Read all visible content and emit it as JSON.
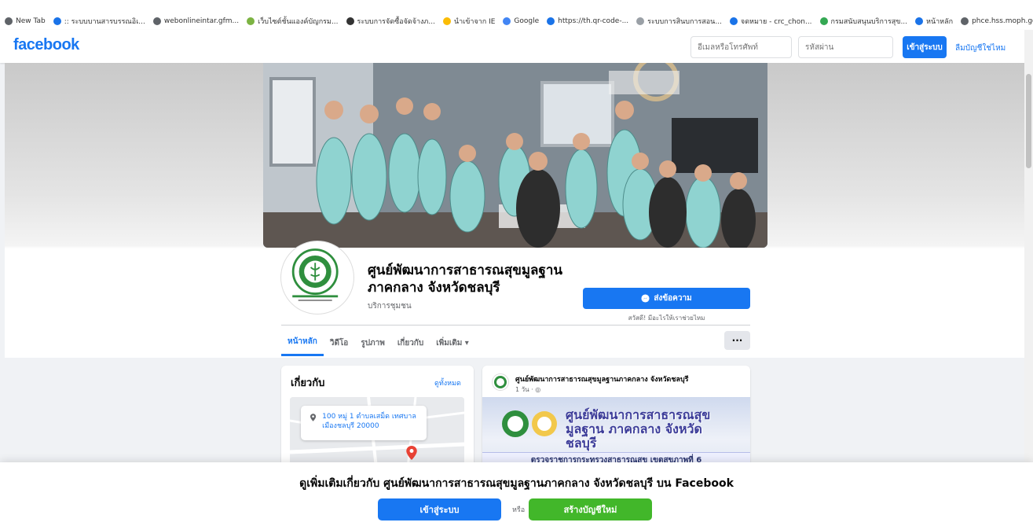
{
  "browser": {
    "bookmarks": [
      "New Tab",
      ":: ระบบบานสารบรรณอิเ...",
      "webonlineintar.gfm...",
      "เว็บไซต์ชั้นแองค์บัญกรม...",
      "ระบบการจัดซื้อจัดจ้างภ...",
      "นำเข้าจาก IE",
      "Google",
      "https://th.qr-code-...",
      "ระบบการสินบการสอน...",
      "จดหมาย - crc_chon...",
      "กรมสนับสนุนบริการสุข...",
      "หน้าหลัก",
      "phce.hss.moph.go.t..."
    ]
  },
  "header": {
    "logo": "facebook",
    "email_placeholder": "อีเมลหรือโทรศัพท์",
    "password_placeholder": "รหัสผ่าน",
    "login_label": "เข้าสู่ระบบ",
    "forgot_label": "ลืมบัญชีใช่ไหม"
  },
  "profile": {
    "name": "ศูนย์พัฒนาการสาธารณสุขมูลฐานภาคกลาง จังหวัดชลบุรี",
    "category": "บริการชุมชน",
    "message_label": "ส่งข้อความ",
    "message_hint": "สวัสดี! มีอะไรให้เราช่วยไหม"
  },
  "tabs": [
    {
      "label": "หน้าหลัก",
      "active": true
    },
    {
      "label": "วิดีโอ",
      "active": false
    },
    {
      "label": "รูปภาพ",
      "active": false
    },
    {
      "label": "เกี่ยวกับ",
      "active": false
    },
    {
      "label": "เพิ่มเติม ▾",
      "active": false
    }
  ],
  "more_label": "···",
  "about": {
    "title": "เกี่ยวกับ",
    "see_all": "ดูทั้งหมด",
    "address": "100 หมู่ 1 ตำบลเสม็ด เทศบาลเมืองชลบุรี 20000"
  },
  "post": {
    "author": "ศูนย์พัฒนาการสาธารณสุขมูลฐานภาคกลาง จังหวัดชลบุรี",
    "time": "1 วัน · ◎",
    "banner_title": "ศูนย์พัฒนาการสาธารณสุขมูลฐาน ภาคกลาง จังหวัดชลบุรี",
    "banner_sub": "ตรวจราชการกระทรวงสาธารณสุข เขตสุขภาพที่ 6"
  },
  "overlay": {
    "text": "ดูเพิ่มเติมเกี่ยวกับ ศูนย์พัฒนาการสาธารณสุขมูลฐานภาคกลาง จังหวัดชลบุรี บน Facebook",
    "login_label": "เข้าสู่ระบบ",
    "or_label": "หรือ",
    "signup_label": "สร้างบัญชีใหม่"
  },
  "colors": {
    "brand": "#1877f2",
    "signup": "#42b72a",
    "page_bg": "#f0f2f5"
  }
}
